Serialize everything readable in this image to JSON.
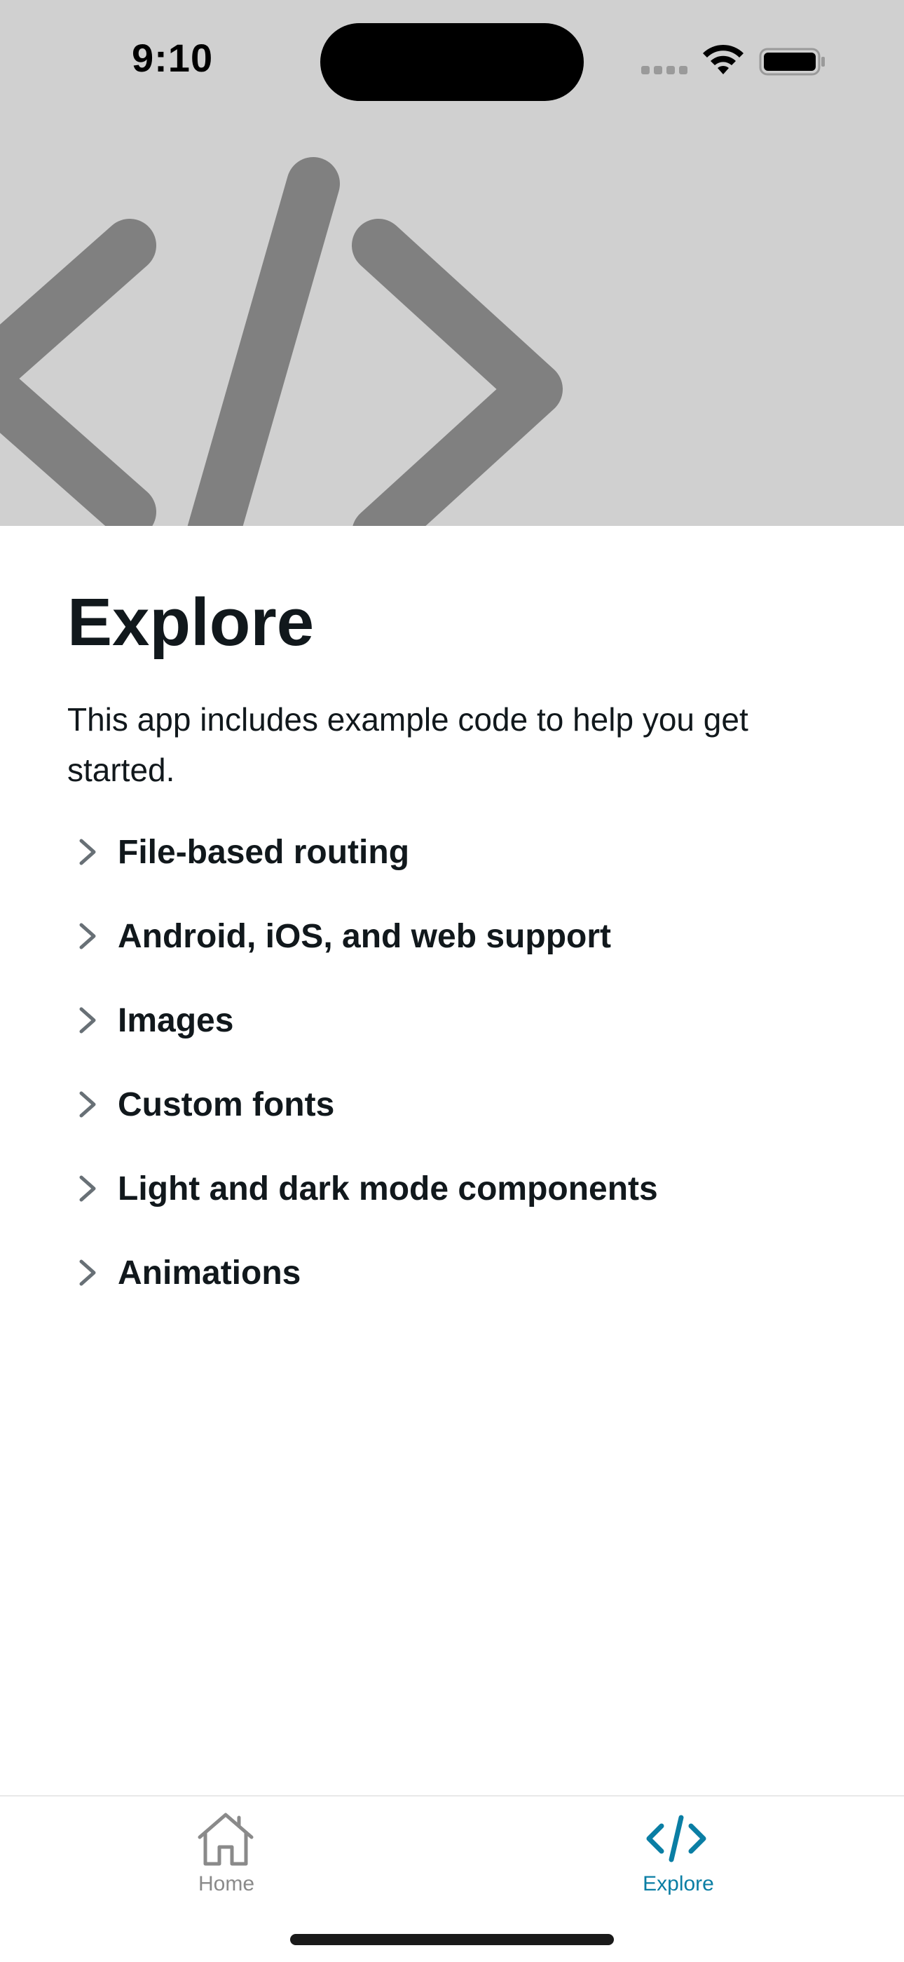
{
  "status_bar": {
    "time": "9:10"
  },
  "header": {
    "icon": "code-brackets-icon",
    "background_color": "#D0D0D0",
    "icon_color": "#808080"
  },
  "main": {
    "title": "Explore",
    "intro": "This app includes example code to help you get started.",
    "features": [
      {
        "label": "File-based routing",
        "icon": "chevron-right-icon"
      },
      {
        "label": "Android, iOS, and web support",
        "icon": "chevron-right-icon"
      },
      {
        "label": "Images",
        "icon": "chevron-right-icon"
      },
      {
        "label": "Custom fonts",
        "icon": "chevron-right-icon"
      },
      {
        "label": "Light and dark mode components",
        "icon": "chevron-right-icon"
      },
      {
        "label": "Animations",
        "icon": "chevron-right-icon"
      }
    ]
  },
  "tab_bar": {
    "tabs": [
      {
        "label": "Home",
        "icon": "house-icon",
        "active": false
      },
      {
        "label": "Explore",
        "icon": "code-icon",
        "active": true
      }
    ],
    "active_color": "#0a7ea4",
    "inactive_color": "#8a8a8a"
  }
}
